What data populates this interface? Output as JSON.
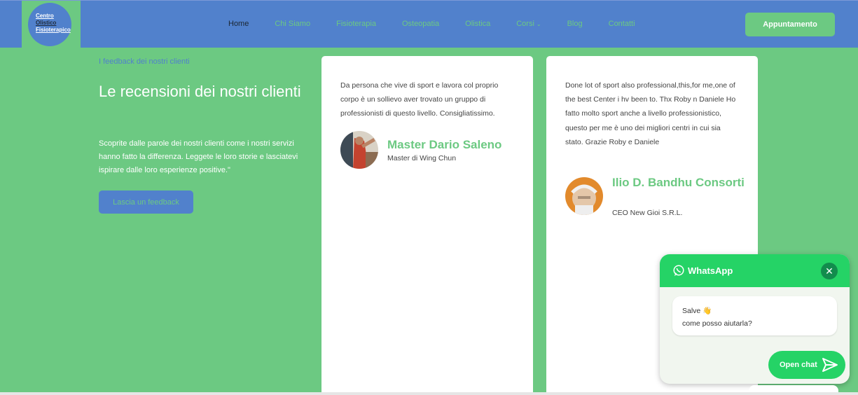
{
  "brand": {
    "logo_line1": "Centro",
    "logo_line2": "Olistico",
    "logo_line3": "Fisioterapico"
  },
  "nav": {
    "items": [
      {
        "label": "Home"
      },
      {
        "label": "Chi Siamo"
      },
      {
        "label": "Fisioterapia"
      },
      {
        "label": "Osteopatia"
      },
      {
        "label": "Olistica"
      },
      {
        "label": "Corsi"
      },
      {
        "label": "Blog"
      },
      {
        "label": "Contatti"
      }
    ],
    "cta_label": "Appuntamento"
  },
  "intro": {
    "kicker": "I feedback dei nostri clienti",
    "title": "Le recensioni dei nostri clienti",
    "lead": "Scoprite dalle parole dei nostri clienti come i nostri servizi hanno fatto la differenza. Leggete le loro storie e lasciatevi ispirare dalle loro esperienze positive.\"",
    "button_label": "Lascia un feedback"
  },
  "testimonials": [
    {
      "quote": "Da persona che vive di sport e lavora col proprio corpo è un sollievo aver trovato un gruppo di professionisti di questo livello. Consigliatissimo.",
      "name": "Master Dario Saleno",
      "role": "Master di Wing Chun"
    },
    {
      "quote": "Done lot of sport also professional,this,for me,one of the best Center i hv been to. Thx Roby n Daniele Ho fatto molto sport anche a livello professionistico, questo per me è uno dei migliori centri in cui sia stato. Grazie Roby e Daniele",
      "name": "Ilio D. Bandhu Consorti",
      "role": "CEO New Gioi S.R.L."
    }
  ],
  "whatsapp": {
    "title": "WhatsApp",
    "greeting": "Salve 👋",
    "message": "come posso aiutarla?",
    "open_label": "Open chat"
  },
  "colors": {
    "primary_blue": "#5181cc",
    "primary_green": "#6cc982",
    "whatsapp_green": "#25d366"
  }
}
